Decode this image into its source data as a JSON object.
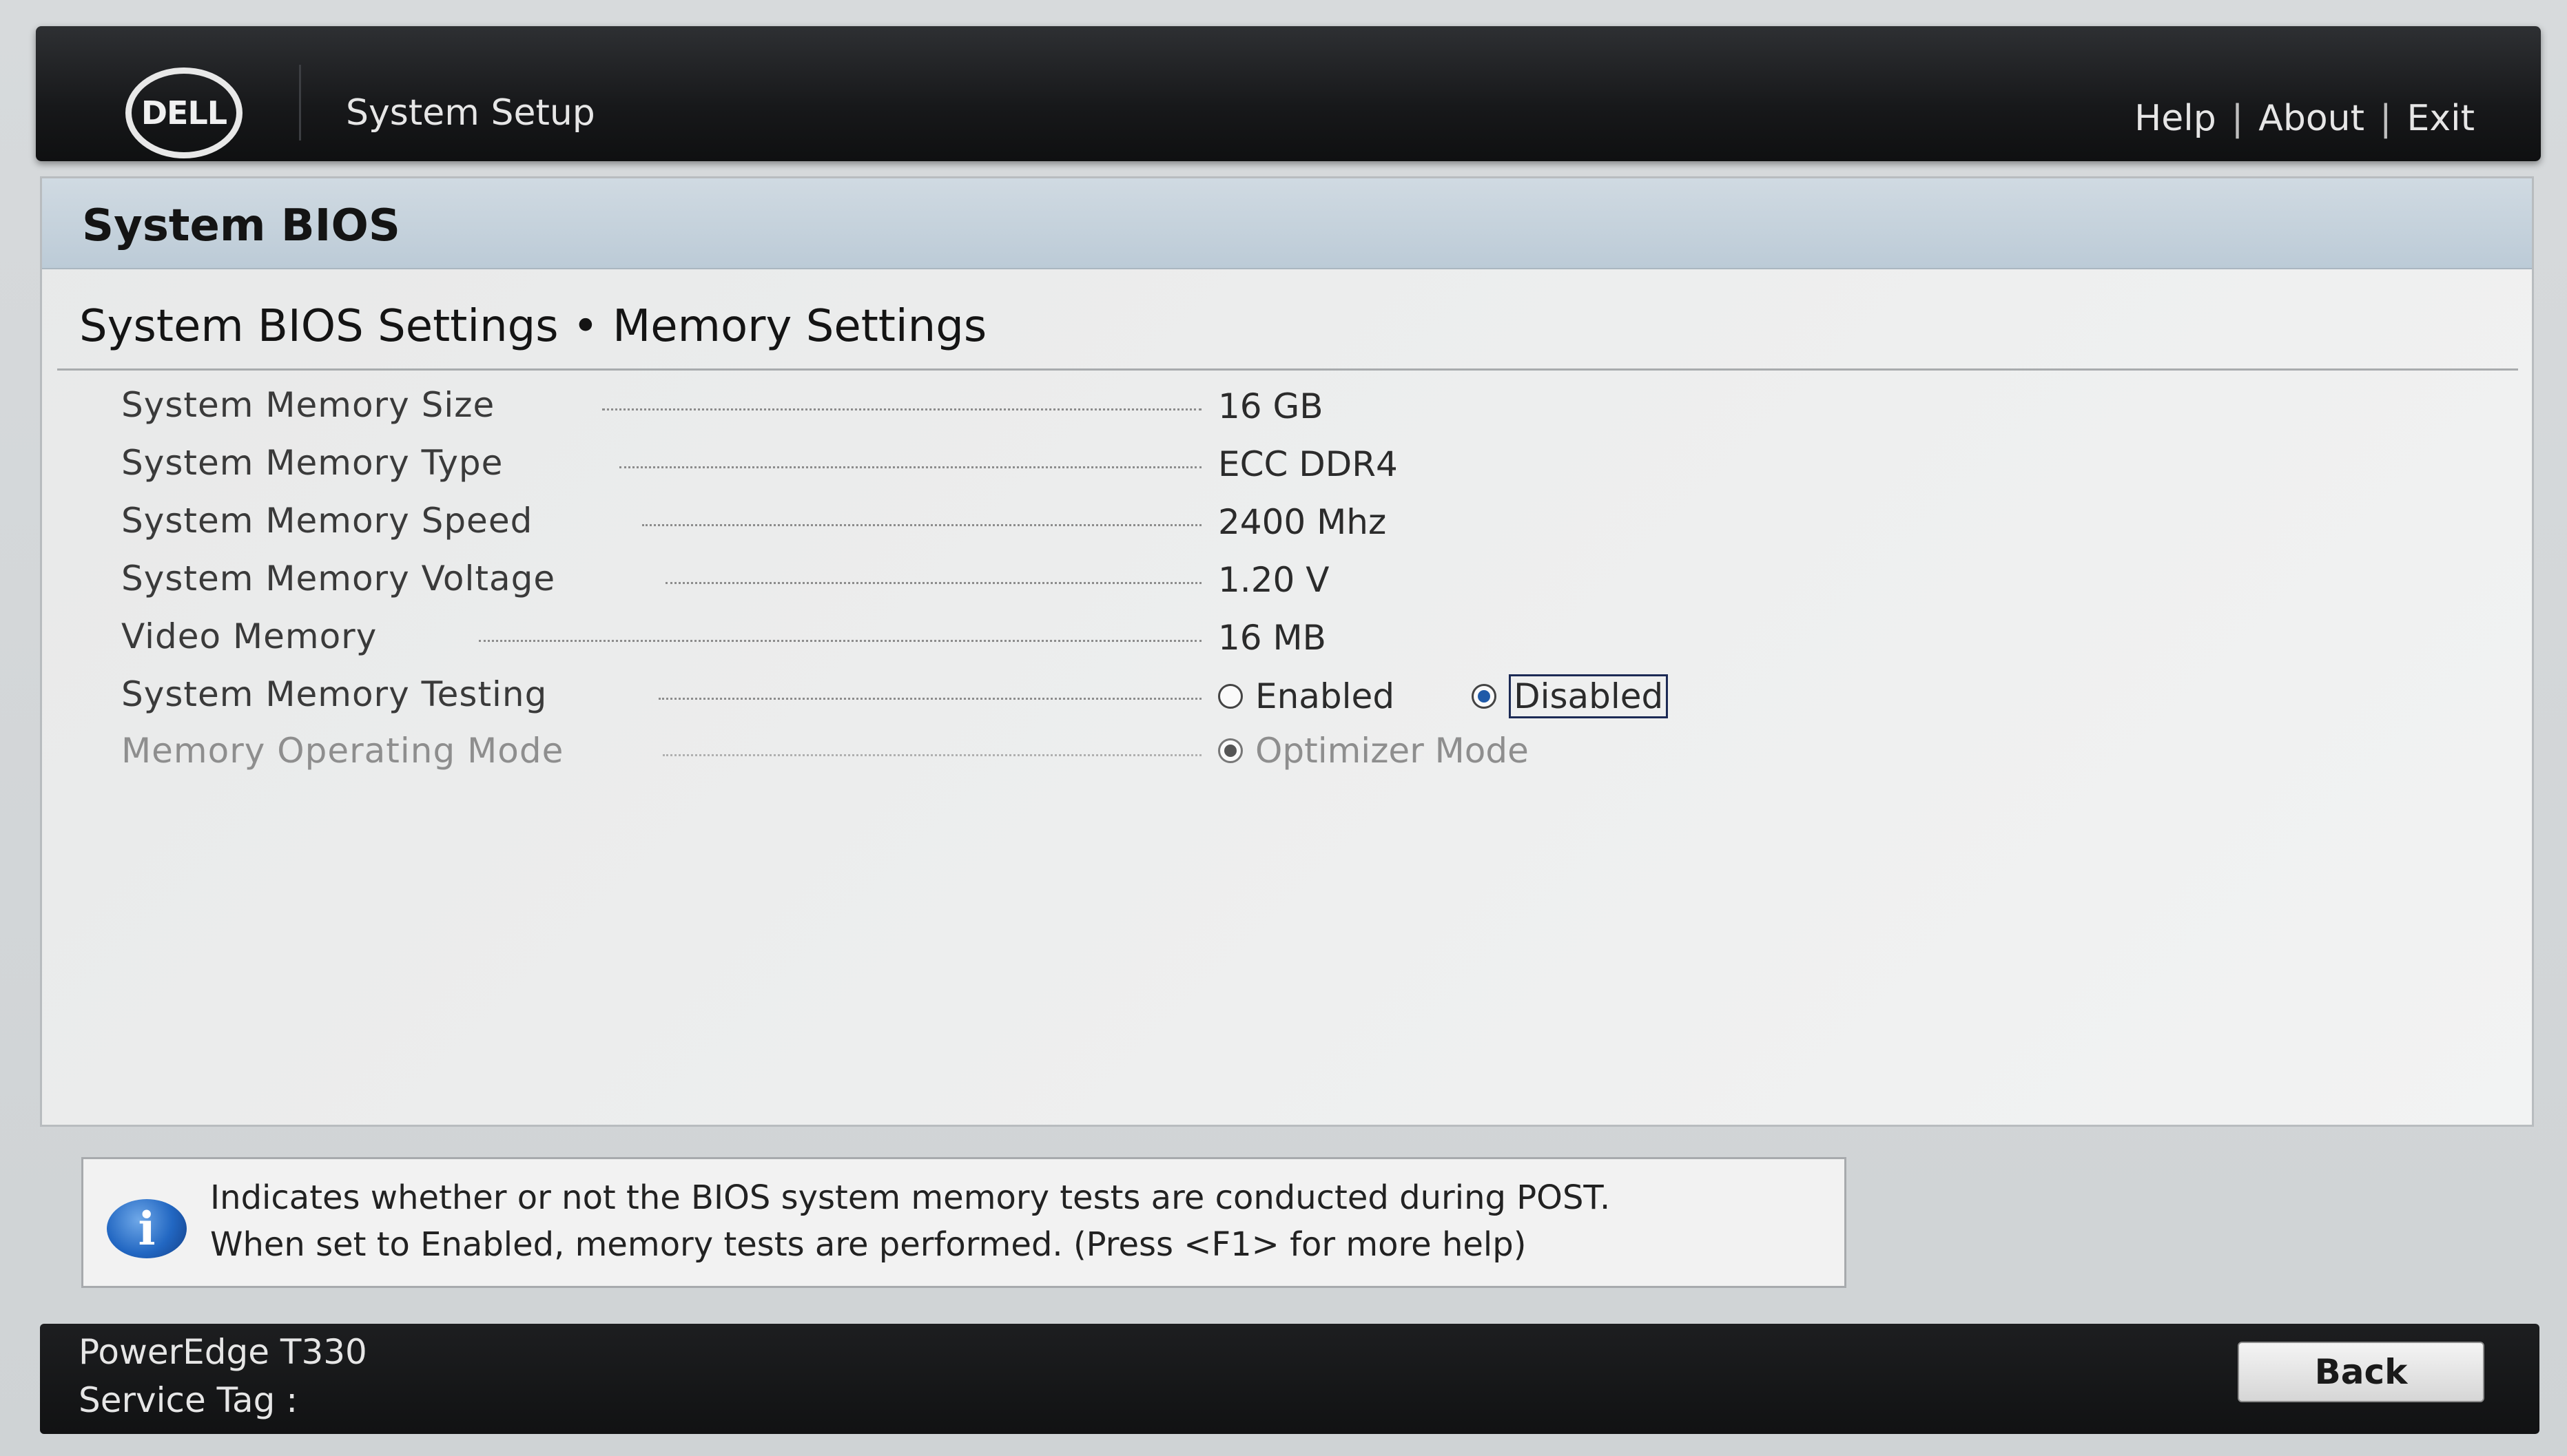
{
  "header": {
    "logo_text": "DELL",
    "app_title": "System Setup",
    "links": [
      "Help",
      "About",
      "Exit"
    ],
    "separator": "|"
  },
  "panel": {
    "title": "System BIOS",
    "subheading": "System BIOS Settings • Memory Settings"
  },
  "settings": [
    {
      "label": "System Memory Size",
      "value": "16 GB"
    },
    {
      "label": "System Memory Type",
      "value": "ECC DDR4"
    },
    {
      "label": "System Memory Speed",
      "value": "2400 Mhz"
    },
    {
      "label": "System Memory Voltage",
      "value": "1.20 V"
    },
    {
      "label": "Video Memory",
      "value": "16 MB"
    }
  ],
  "memory_testing": {
    "label": "System Memory Testing",
    "options": [
      "Enabled",
      "Disabled"
    ],
    "selected": "Disabled"
  },
  "operating_mode": {
    "label": "Memory Operating Mode",
    "option": "Optimizer Mode",
    "state": "disabled"
  },
  "help": {
    "line1": "Indicates whether or not the BIOS system memory tests are conducted during POST.",
    "line2": "When set to Enabled, memory tests are performed. (Press <F1> for more help)"
  },
  "footer": {
    "model": "PowerEdge T330",
    "service_tag_label": "Service Tag :",
    "back_label": "Back"
  },
  "colors": {
    "topbar": "#17181a",
    "panel_header": "#c4d1dc",
    "selected_radio": "#1f5aa8",
    "info_icon": "#2267c2"
  }
}
